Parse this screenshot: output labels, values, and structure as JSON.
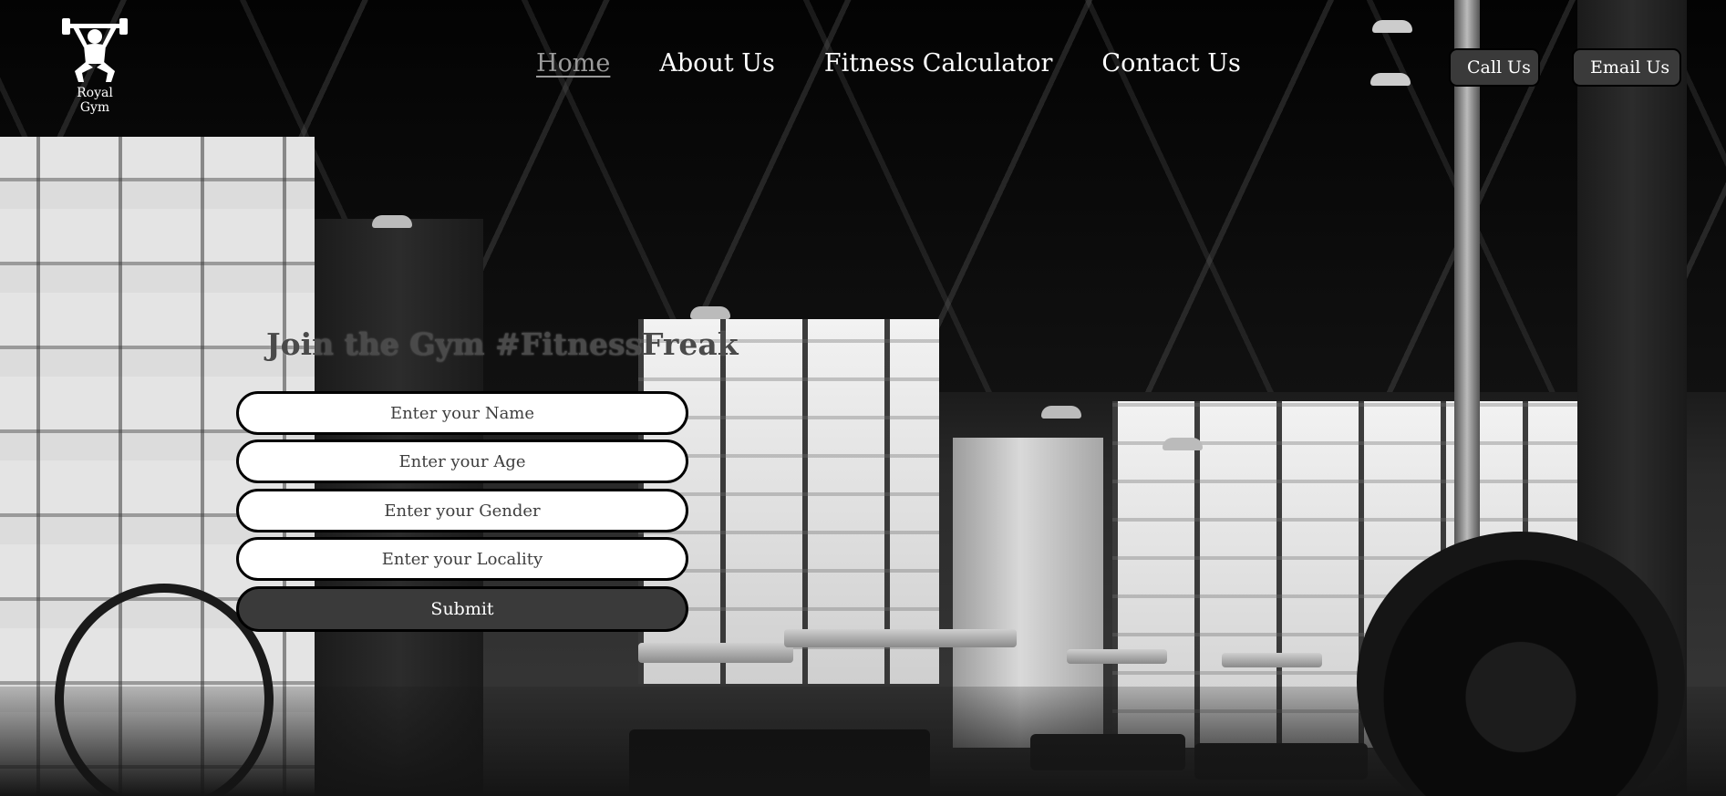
{
  "brand": {
    "name": "Royal Gym",
    "logo_icon": "weightlifter-icon"
  },
  "nav": {
    "items": [
      {
        "label": "Home",
        "active": true
      },
      {
        "label": "About Us",
        "active": false
      },
      {
        "label": "Fitness Calculator",
        "active": false
      },
      {
        "label": "Contact Us",
        "active": false
      }
    ]
  },
  "header_actions": {
    "call_label": "Call Us",
    "email_label": "Email Us"
  },
  "form": {
    "title": "Join the Gym #FitnessFreak",
    "fields": {
      "name_placeholder": "Enter your Name",
      "age_placeholder": "Enter your Age",
      "gender_placeholder": "Enter your Gender",
      "locality_placeholder": "Enter your Locality"
    },
    "submit_label": "Submit"
  },
  "colors": {
    "button_bg": "#3a3a3a",
    "active_nav": "#9a9a9a",
    "title_text": "#4a4a4a"
  }
}
